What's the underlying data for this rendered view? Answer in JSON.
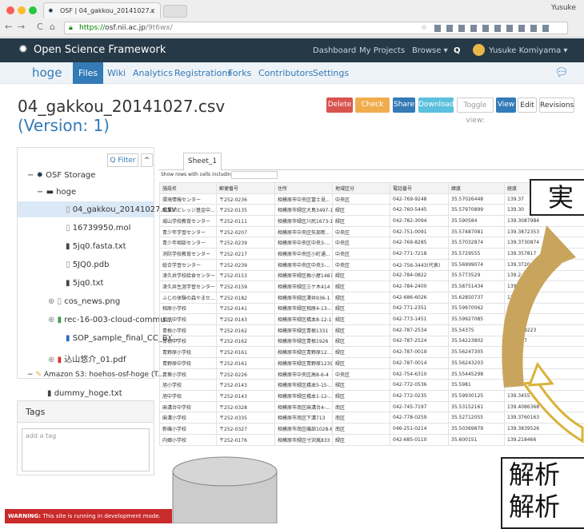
{
  "browser": {
    "tab_title": "OSF | 04_gakkou_20141027.c",
    "tab_close": "×",
    "user": "Yusuke",
    "url_secure": "https://",
    "url_host": "osf.nii.ac.jp",
    "url_path": "/9t6wx/",
    "back": "←",
    "forward": "→",
    "reload": "C",
    "home": "⌂",
    "star": "☆"
  },
  "osf_nav": {
    "brand": "Open Science Framework",
    "dashboard": "Dashboard",
    "my_projects": "My Projects",
    "browse": "Browse ▾",
    "search": "Q",
    "user": "Yusuke Komiyama ▾"
  },
  "project_nav": {
    "home": "hoge",
    "files": "Files",
    "wiki": "Wiki",
    "analytics": "Analytics",
    "registrations": "Registrations",
    "forks": "Forks",
    "contributors": "Contributors",
    "settings": "Settings"
  },
  "file": {
    "name": "04_gakkou_20141027.csv",
    "version": "(Version: 1)"
  },
  "toolbar": {
    "delete": "Delete",
    "check_out": "Check out",
    "share": "Share",
    "download": "Download",
    "toggle_view": "Toggle view:",
    "view": "View",
    "edit": "Edit",
    "revisions": "Revisions"
  },
  "sidebar": {
    "filter": "Q Filter",
    "collapse": "^",
    "tree": [
      "OSF Storage",
      "hoge",
      "04_gakkou_20141027.csv",
      "16739950.mol",
      "5jq0.fasta.txt",
      "5JQ0.pdb",
      "5jq0.txt",
      "cos_news.png",
      "rec-16-003-cloud-commu...",
      "SOP_sample_final_CC_BY...",
      "込山悠介_01.pdf",
      "Amazon S3: hoehos-osf-hoge (T...",
      "dummy_hoge.txt"
    ]
  },
  "tags": {
    "title": "Tags",
    "placeholder": "add a tag"
  },
  "warning": {
    "label": "WARNING:",
    "text": "This site is running in development mode."
  },
  "sheet": {
    "tab": "Sheet_1",
    "filter_label": "Show rows with cells including:",
    "columns": [
      "施設名",
      "郵便番号",
      "住所",
      "地域区分",
      "電話番号",
      "緯度",
      "経度"
    ],
    "rows": [
      [
        "環境情報センター",
        "〒252-0236",
        "相模原市中央区富士見...",
        "中央区",
        "042-769-9248",
        "35.57026448",
        "139.37"
      ],
      [
        "職業川ビレッジ基金中...",
        "〒252-0135",
        "相模原市緑区大島3497-1",
        "緑区",
        "042-760-5445",
        "35.57970899",
        "139.30"
      ],
      [
        "城山学校教育センター",
        "〒252-0111",
        "相模原市緑区川尻1673-1",
        "緑区",
        "042-782-3094",
        "35.590584",
        "139.3087984"
      ],
      [
        "青少年学習センター",
        "〒252-0207",
        "相模原市中央区矢部新...",
        "中央区",
        "042-751-0091",
        "35.57487081",
        "139.3872353"
      ],
      [
        "青少年相談センター",
        "〒252-0239",
        "相模原市中央区中央3-...",
        "中央区",
        "042-769-8285",
        "35.57032874",
        "139.3730874"
      ],
      [
        "消防学校教育センター",
        "〒252-0217",
        "相模原市中央区小町通...",
        "中央区",
        "042-771-7218",
        "35.5729555",
        "139.357817"
      ],
      [
        "総合学習センター",
        "〒252-0239",
        "相模原市中央区中央3-...",
        "中央区",
        "042-756-3443(代表)",
        "35.56999074",
        "139.3720"
      ],
      [
        "津久井学校給食センター",
        "〒252-0153",
        "相模原市緑区根小屋1487",
        "緑区",
        "042-784-0822",
        "35.5773529",
        "139.2"
      ],
      [
        "津久井生涯学習センター",
        "〒252-0159",
        "相模原市緑区三ケ木414",
        "緑区",
        "042-784-2400",
        "35.58751434",
        "139.2"
      ],
      [
        "ふじの体験の森やませ...",
        "〒252-0182",
        "相模原市緑区澤井936-1",
        "緑区",
        "042-686-6026",
        "35.62850737",
        "13"
      ],
      [
        "相原小学校",
        "〒252-0141",
        "相模原市緑区相原4-13-...",
        "緑区",
        "042-771-2351",
        "35.59970062",
        "1"
      ],
      [
        "相原中学校",
        "〒252-0143",
        "相模原市緑区橋本8-12-1",
        "緑区",
        "042-773-1451",
        "35.59927085",
        ""
      ],
      [
        "青根小学校",
        "〒252-0162",
        "相模原市緑区青根1331",
        "緑区",
        "042-787-2534",
        "35.54375",
        "139.129223"
      ],
      [
        "青根中学校",
        "〒252-0162",
        "相模原市緑区青根1926",
        "緑区",
        "042-787-2524",
        "35.54223802",
        "139.127"
      ],
      [
        "青野原小学校",
        "〒252-0161",
        "相模原市緑区青野原12...",
        "緑区",
        "042-787-0019",
        "35.56247305",
        "139."
      ],
      [
        "青野原中学校",
        "〒252-0161",
        "相模原市緑区青野原1239",
        "緑区",
        "042-787-0014",
        "35.56243203",
        ""
      ],
      [
        "青葉小学校",
        "〒252-0226",
        "相模原市中央区高8-6-4",
        "中央区",
        "042-754-6310",
        "35.55445298",
        "139.3"
      ],
      [
        "旭小学校",
        "〒252-0143",
        "相模原市緑区橋本5-15-...",
        "緑区",
        "042-772-0536",
        "35.5981",
        "139.343"
      ],
      [
        "旭中学校",
        "〒252-0143",
        "相模原市緑区橋本1-12-...",
        "緑区",
        "042-772-0235",
        "35.59930125",
        "139.3455"
      ],
      [
        "麻溝台中学校",
        "〒252-0328",
        "相模原市南区麻溝台4-...",
        "南区",
        "042-745-7197",
        "35.53152161",
        "139.4086368"
      ],
      [
        "麻溝小学校",
        "〒252-0335",
        "相模原市南区下溝713",
        "南区",
        "042-778-0259",
        "35.52712055",
        "139.3760163"
      ],
      [
        "新磯小学校",
        "〒252-0327",
        "相模原市南区磯部1028-6",
        "南区",
        "046-251-0214",
        "35.50369879",
        "139.3839526"
      ],
      [
        "内郷小学校",
        "〒252-0176",
        "相模原市緑区寸沢嵐833",
        "緑区",
        "042-685-0110",
        "35.600151",
        "139.218466"
      ]
    ]
  },
  "overlay": {
    "callout_top": "実",
    "callout_bottom": "解析\n解析"
  },
  "colors": {
    "osf_nav_bg": "#263947",
    "delete": "#d9534f",
    "check_out": "#f0ad4e",
    "share": "#337ab7",
    "download": "#5bc0de",
    "view_active": "#337ab7",
    "warning_bg": "#c92a2a",
    "arrow": "#c9a45c"
  }
}
